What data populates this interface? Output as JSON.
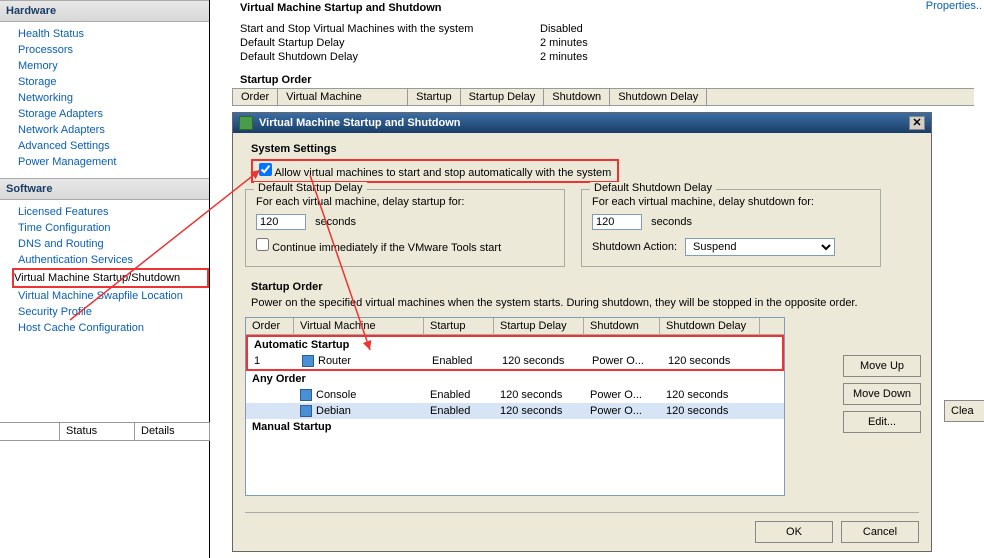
{
  "sidebar": {
    "hardware_title": "Hardware",
    "hardware": [
      "Health Status",
      "Processors",
      "Memory",
      "Storage",
      "Networking",
      "Storage Adapters",
      "Network Adapters",
      "Advanced Settings",
      "Power Management"
    ],
    "software_title": "Software",
    "software": [
      "Licensed Features",
      "Time Configuration",
      "DNS and Routing",
      "Authentication Services",
      "Virtual Machine Startup/Shutdown",
      "Virtual Machine Swapfile Location",
      "Security Profile",
      "Host Cache Configuration"
    ],
    "selected_index": 4
  },
  "status": {
    "c1": "Status",
    "c2": "Details"
  },
  "bg": {
    "title": "Virtual Machine Startup and Shutdown",
    "rows": [
      {
        "lbl": "Start and Stop Virtual Machines with the system",
        "val": "Disabled"
      },
      {
        "lbl": "Default Startup Delay",
        "val": "2 minutes"
      },
      {
        "lbl": "Default Shutdown Delay",
        "val": "2 minutes"
      }
    ],
    "props": "Properties..",
    "subtitle": "Startup Order",
    "cols": [
      "Order",
      "Virtual Machine",
      "Startup",
      "Startup Delay",
      "Shutdown",
      "Shutdown Delay"
    ]
  },
  "dialog": {
    "title": "Virtual Machine Startup and Shutdown",
    "system_settings": "System Settings",
    "allow_label": "Allow virtual machines to start and stop automatically with the system",
    "allow_checked": true,
    "startup_box": {
      "title": "Default Startup Delay",
      "desc": "For each virtual machine, delay startup for:",
      "value": "120",
      "unit": "seconds",
      "cont_label": "Continue immediately if the VMware Tools start",
      "cont_checked": false
    },
    "shutdown_box": {
      "title": "Default Shutdown Delay",
      "desc": "For each virtual machine, delay shutdown for:",
      "value": "120",
      "unit": "seconds",
      "action_label": "Shutdown Action:",
      "action_value": "Suspend"
    },
    "order": {
      "title": "Startup Order",
      "desc": "Power on the specified virtual machines when the system starts. During shutdown, they will be stopped in the opposite order.",
      "cols": [
        "Order",
        "Virtual Machine",
        "Startup",
        "Startup Delay",
        "Shutdown",
        "Shutdown Delay"
      ],
      "g1": "Automatic Startup",
      "g2": "Any Order",
      "g3": "Manual Startup",
      "rows_auto": [
        {
          "order": "1",
          "vm": "Router",
          "start": "Enabled",
          "sd": "120 seconds",
          "sh": "Power O...",
          "shd": "120 seconds"
        }
      ],
      "rows_any": [
        {
          "order": "",
          "vm": "Console",
          "start": "Enabled",
          "sd": "120 seconds",
          "sh": "Power O...",
          "shd": "120 seconds"
        },
        {
          "order": "",
          "vm": "Debian",
          "start": "Enabled",
          "sd": "120 seconds",
          "sh": "Power O...",
          "shd": "120 seconds"
        }
      ]
    },
    "buttons": {
      "up": "Move Up",
      "down": "Move Down",
      "edit": "Edit...",
      "ok": "OK",
      "cancel": "Cancel"
    }
  },
  "clear_btn": "Clea"
}
